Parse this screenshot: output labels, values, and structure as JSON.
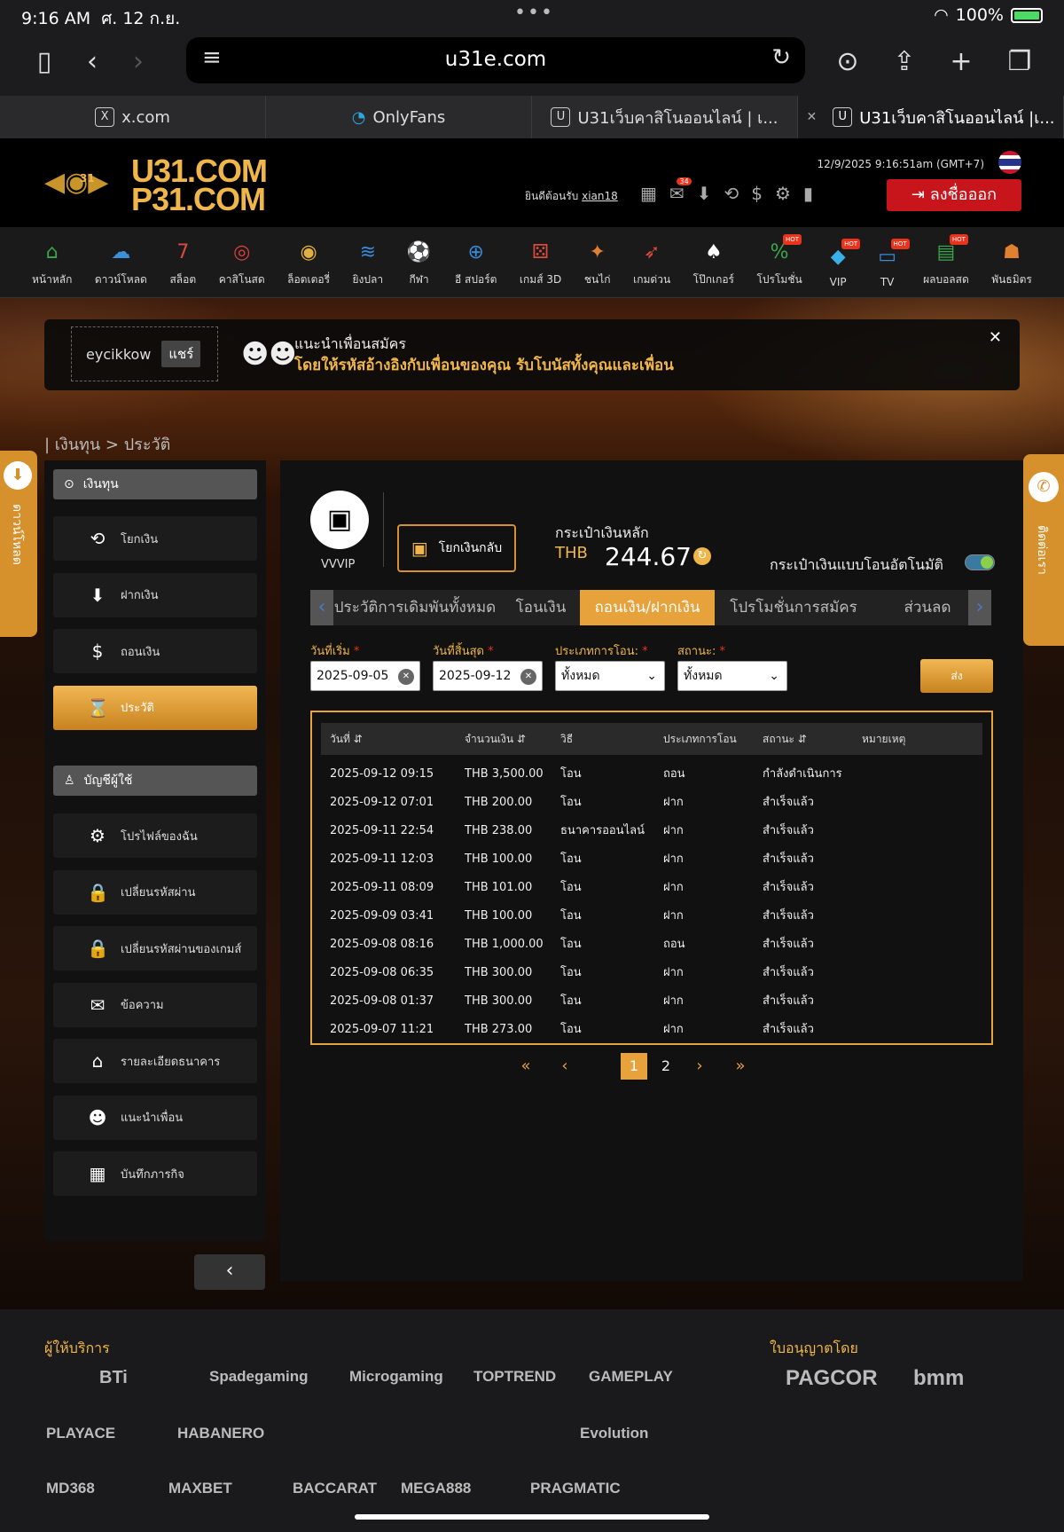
{
  "status": {
    "time": "9:16 AM",
    "date": "ศ. 12 ก.ย.",
    "battery": "100%"
  },
  "browser": {
    "url": "u31e.com",
    "tabs": [
      {
        "label": "x.com",
        "fav": "X"
      },
      {
        "label": "OnlyFans",
        "fav": "◔"
      },
      {
        "label": "U31เว็บคาสิโนออนไลน์ | เ...",
        "fav": "U"
      },
      {
        "label": "U31เว็บคาสิโนออนไลน์ |เ...",
        "fav": "U"
      }
    ],
    "tab_close": "✕"
  },
  "header": {
    "logo_line1": "U31.COM",
    "logo_line2": "P31.COM",
    "logo_badge": "31",
    "datetime": "12/9/2025 9:16:51am (GMT+7)",
    "welcome_prefix": "ยินดีต้อนรับ",
    "username": "xian18",
    "mail_badge": "34",
    "logout_label": "ลงชื่อออก"
  },
  "nav": [
    {
      "label": "หน้าหลัก",
      "icon": "home-icon",
      "glyph": "⌂",
      "color": "#3aa84a"
    },
    {
      "label": "ดาวน์โหลด",
      "icon": "cloud-download-icon",
      "glyph": "☁",
      "color": "#3c8fd8"
    },
    {
      "label": "สล็อต",
      "icon": "slot-icon",
      "glyph": "7",
      "color": "#d84a3a"
    },
    {
      "label": "คาสิโนสด",
      "icon": "casino-chip-icon",
      "glyph": "◎",
      "color": "#d8403a"
    },
    {
      "label": "ล็อตเตอรี่",
      "icon": "lottery-icon",
      "glyph": "◉",
      "color": "#e0b040"
    },
    {
      "label": "ยิงปลา",
      "icon": "fish-icon",
      "glyph": "≋",
      "color": "#3a8ad8"
    },
    {
      "label": "กีฬา",
      "icon": "soccer-ball-icon",
      "glyph": "⚽",
      "color": "#ffffff"
    },
    {
      "label": "อี สปอร์ต",
      "icon": "gamepad-icon",
      "glyph": "⊕",
      "color": "#3a8ad8"
    },
    {
      "label": "เกมส์ 3D",
      "icon": "dice-icon",
      "glyph": "⚄",
      "color": "#d84a3a"
    },
    {
      "label": "ชนไก่",
      "icon": "rooster-icon",
      "glyph": "✦",
      "color": "#e08030"
    },
    {
      "label": "เกมด่วน",
      "icon": "rocket-icon",
      "glyph": "➶",
      "color": "#d84a3a"
    },
    {
      "label": "โป๊กเกอร์",
      "icon": "cards-icon",
      "glyph": "♠",
      "color": "#ffffff"
    },
    {
      "label": "โปรโมชั่น",
      "icon": "promotion-icon",
      "glyph": "%",
      "color": "#3aa84a",
      "hot": true
    },
    {
      "label": "VIP",
      "icon": "diamond-icon",
      "glyph": "◆",
      "color": "#3ab0e8",
      "hot": true
    },
    {
      "label": "TV",
      "icon": "tv-icon",
      "glyph": "▭",
      "color": "#3a8ad8",
      "hot": true
    },
    {
      "label": "ผลบอลสด",
      "icon": "live-score-icon",
      "glyph": "▤",
      "color": "#3aa84a",
      "hot": true
    },
    {
      "label": "พันธมิตร",
      "icon": "partners-icon",
      "glyph": "☗",
      "color": "#e08030"
    }
  ],
  "referral": {
    "code": "eycikkow",
    "share_label": "แชร์",
    "title": "แนะนำเพื่อนสมัคร",
    "subtitle": "โดยให้รหัสอ้างอิงกับเพื่อนของคุณ รับโบนัสทั้งคุณและเพื่อน"
  },
  "breadcrumb": "| เงินทุน > ประวัติ",
  "side_tabs": {
    "download": "ดาวน์โหลด",
    "contact": "ติดต่อเรา"
  },
  "sidebar": {
    "funds_title": "เงินทุน",
    "funds_items": [
      {
        "label": "โยกเงิน",
        "icon": "transfer-icon",
        "glyph": "⟲"
      },
      {
        "label": "ฝากเงิน",
        "icon": "deposit-icon",
        "glyph": "⬇"
      },
      {
        "label": "ถอนเงิน",
        "icon": "withdraw-icon",
        "glyph": "$"
      },
      {
        "label": "ประวัติ",
        "icon": "hourglass-icon",
        "glyph": "⌛",
        "active": true
      }
    ],
    "account_title": "บัญชีผู้ใช้",
    "account_items": [
      {
        "label": "โปรไฟล์ของฉัน",
        "icon": "gears-icon",
        "glyph": "⚙"
      },
      {
        "label": "เปลี่ยนรหัสผ่าน",
        "icon": "lock-icon",
        "glyph": "🔒"
      },
      {
        "label": "เปลี่ยนรหัสผ่านของเกมส์",
        "icon": "lock-icon",
        "glyph": "🔒"
      },
      {
        "label": "ข้อความ",
        "icon": "envelope-icon",
        "glyph": "✉"
      },
      {
        "label": "รายละเอียดธนาคาร",
        "icon": "bank-icon",
        "glyph": "⌂"
      },
      {
        "label": "แนะนำเพื่อน",
        "icon": "friends-icon",
        "glyph": "☻"
      },
      {
        "label": "บันทึกภารกิจ",
        "icon": "calendar-icon",
        "glyph": "▦"
      }
    ]
  },
  "profile": {
    "vip": "VVVIP",
    "withdraw_back": "โยกเงินกลับ",
    "wallet_title": "กระเป๋าเงินหลัก",
    "currency": "THB",
    "balance": "244.67",
    "auto_wallet": "กระเป๋าเงินแบบโอนอัตโนมัติ"
  },
  "subtabs": [
    "ประวัติการเดิมพันทั้งหมด",
    "โอนเงิน",
    "ถอนเงิน/ฝากเงิน",
    "โปรโมชั่นการสมัคร",
    "ส่วนลด"
  ],
  "filters": {
    "start_label": "วันที่เริ่ม",
    "start_value": "2025-09-05",
    "end_label": "วันที่สิ้นสุด",
    "end_value": "2025-09-12",
    "type_label": "ประเภทการโอน:",
    "type_value": "ทั้งหมด",
    "status_label": "สถานะ:",
    "status_value": "ทั้งหมด",
    "submit": "ส่ง"
  },
  "table": {
    "headers": [
      "วันที่ ⇵",
      "จำนวนเงิน ⇵",
      "วิธี",
      "ประเภทการโอน",
      "สถานะ ⇵",
      "หมายเหตุ"
    ],
    "rows": [
      [
        "2025-09-12 09:15",
        "THB 3,500.00",
        "โอน",
        "ถอน",
        "กำลังดำเนินการ",
        ""
      ],
      [
        "2025-09-12 07:01",
        "THB 200.00",
        "โอน",
        "ฝาก",
        "สำเร็จแล้ว",
        ""
      ],
      [
        "2025-09-11 22:54",
        "THB 238.00",
        "ธนาคารออนไลน์",
        "ฝาก",
        "สำเร็จแล้ว",
        ""
      ],
      [
        "2025-09-11 12:03",
        "THB 100.00",
        "โอน",
        "ฝาก",
        "สำเร็จแล้ว",
        ""
      ],
      [
        "2025-09-11 08:09",
        "THB 101.00",
        "โอน",
        "ฝาก",
        "สำเร็จแล้ว",
        ""
      ],
      [
        "2025-09-09 03:41",
        "THB 100.00",
        "โอน",
        "ฝาก",
        "สำเร็จแล้ว",
        ""
      ],
      [
        "2025-09-08 08:16",
        "THB 1,000.00",
        "โอน",
        "ถอน",
        "สำเร็จแล้ว",
        ""
      ],
      [
        "2025-09-08 06:35",
        "THB 300.00",
        "โอน",
        "ฝาก",
        "สำเร็จแล้ว",
        ""
      ],
      [
        "2025-09-08 01:37",
        "THB 300.00",
        "โอน",
        "ฝาก",
        "สำเร็จแล้ว",
        ""
      ],
      [
        "2025-09-07 11:21",
        "THB 273.00",
        "โอน",
        "ฝาก",
        "สำเร็จแล้ว",
        ""
      ]
    ]
  },
  "pagination": {
    "first": "«",
    "prev": "‹",
    "pages": [
      "1",
      "2"
    ],
    "current": "1",
    "next": "›",
    "last": "»"
  },
  "footer": {
    "providers_title": "ผู้ให้บริการ",
    "license_title": "ใบอนุญาตโดย",
    "providers": [
      "BTi",
      "Spadegaming",
      "Microgaming",
      "TOPTREND",
      "GAMEPLAY",
      "PLAYACE",
      "HABANERO",
      "Evolution",
      "MD368",
      "MAXBET",
      "BACCARAT",
      "MEGA888",
      "PRAGMATIC"
    ],
    "licenses": [
      "PAGCOR",
      "bmm"
    ]
  }
}
